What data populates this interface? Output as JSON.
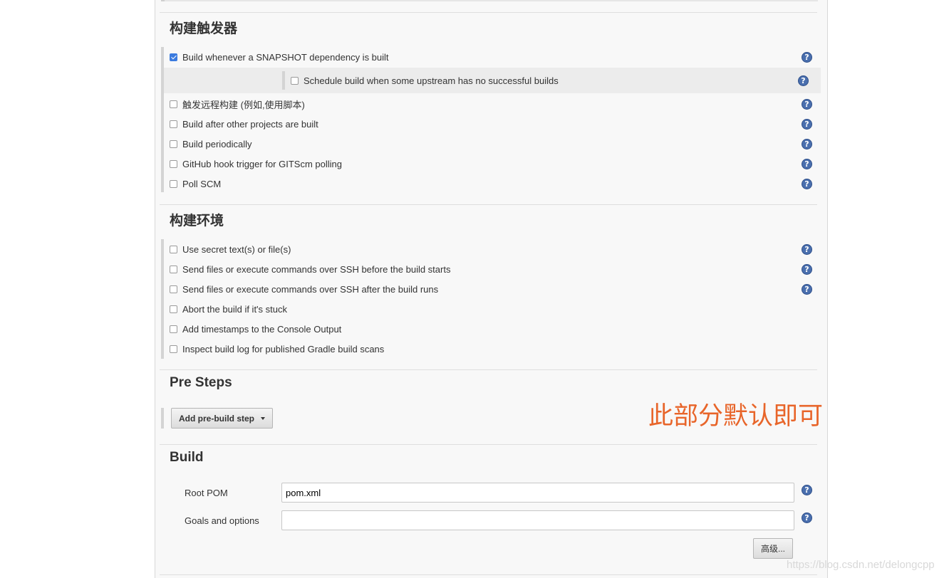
{
  "build_triggers": {
    "title": "构建触发器",
    "items": [
      {
        "label": "Build whenever a SNAPSHOT dependency is built",
        "checked": true
      },
      {
        "label": "Schedule build when some upstream has no successful builds",
        "checked": false
      },
      {
        "label": "触发远程构建 (例如,使用脚本)",
        "checked": false
      },
      {
        "label": "Build after other projects are built",
        "checked": false
      },
      {
        "label": "Build periodically",
        "checked": false
      },
      {
        "label": "GitHub hook trigger for GITScm polling",
        "checked": false
      },
      {
        "label": "Poll SCM",
        "checked": false
      }
    ]
  },
  "build_environment": {
    "title": "构建环境",
    "items": [
      {
        "label": "Use secret text(s) or file(s)",
        "checked": false
      },
      {
        "label": "Send files or execute commands over SSH before the build starts",
        "checked": false
      },
      {
        "label": "Send files or execute commands over SSH after the build runs",
        "checked": false
      },
      {
        "label": "Abort the build if it's stuck",
        "checked": false
      },
      {
        "label": "Add timestamps to the Console Output",
        "checked": false
      },
      {
        "label": "Inspect build log for published Gradle build scans",
        "checked": false
      }
    ]
  },
  "pre_steps": {
    "title": "Pre Steps",
    "add_button_label": "Add pre-build step",
    "annotation": "此部分默认即可"
  },
  "build": {
    "title": "Build",
    "root_pom_label": "Root POM",
    "root_pom_value": "pom.xml",
    "goals_label": "Goals and options",
    "goals_value": "",
    "advanced_button_label": "高级..."
  },
  "help_icon_glyph": "?",
  "watermark": "https://blog.csdn.net/delongcpp",
  "colors": {
    "checkbox_checked": "#3b7bdf",
    "help_icon": "#4a6fae",
    "annotation": "#e8652a"
  }
}
